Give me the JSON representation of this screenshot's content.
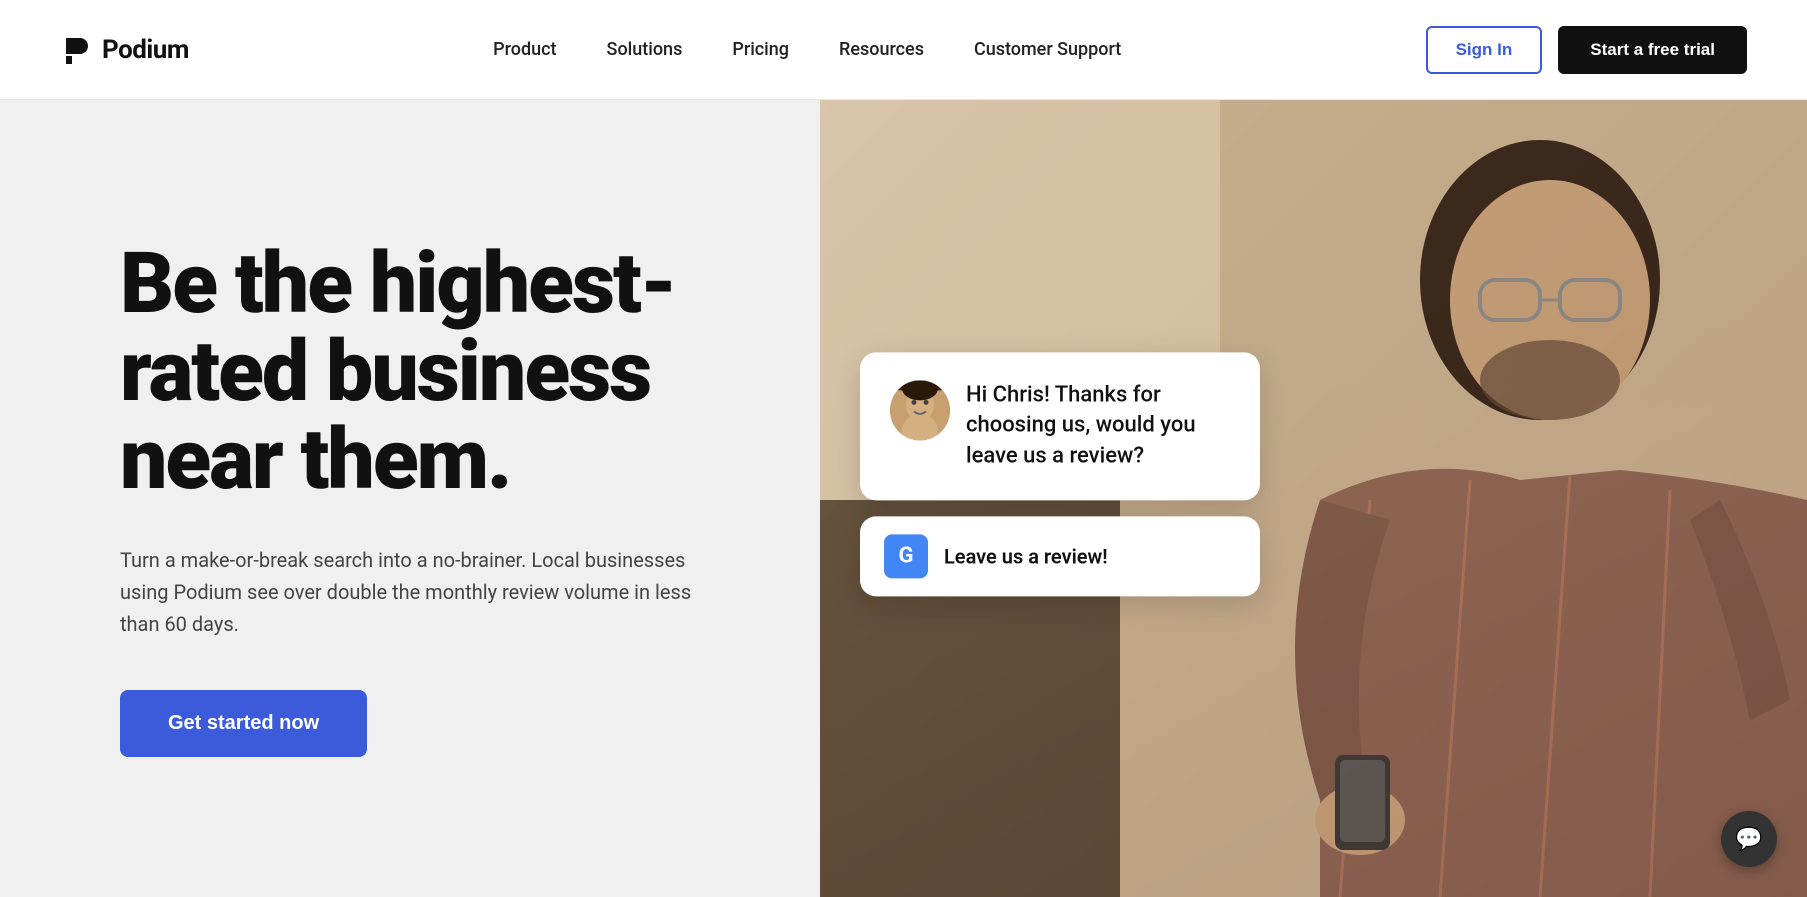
{
  "header": {
    "logo_text": "Podium",
    "nav_items": [
      {
        "label": "Product",
        "id": "product"
      },
      {
        "label": "Solutions",
        "id": "solutions"
      },
      {
        "label": "Pricing",
        "id": "pricing"
      },
      {
        "label": "Resources",
        "id": "resources"
      },
      {
        "label": "Customer Support",
        "id": "customer-support"
      }
    ],
    "sign_in_label": "Sign In",
    "free_trial_label": "Start a free trial"
  },
  "hero": {
    "headline": "Be the highest-rated business near them.",
    "subtext": "Turn a make-or-break search into a no-brainer. Local businesses using Podium see over double the monthly review volume in less than 60 days.",
    "cta_label": "Get started now",
    "chat_bubble": {
      "message": "Hi Chris! Thanks for choosing us, would you leave us a review?",
      "google_button_text": "Leave us a review!",
      "google_icon_label": "G"
    }
  }
}
